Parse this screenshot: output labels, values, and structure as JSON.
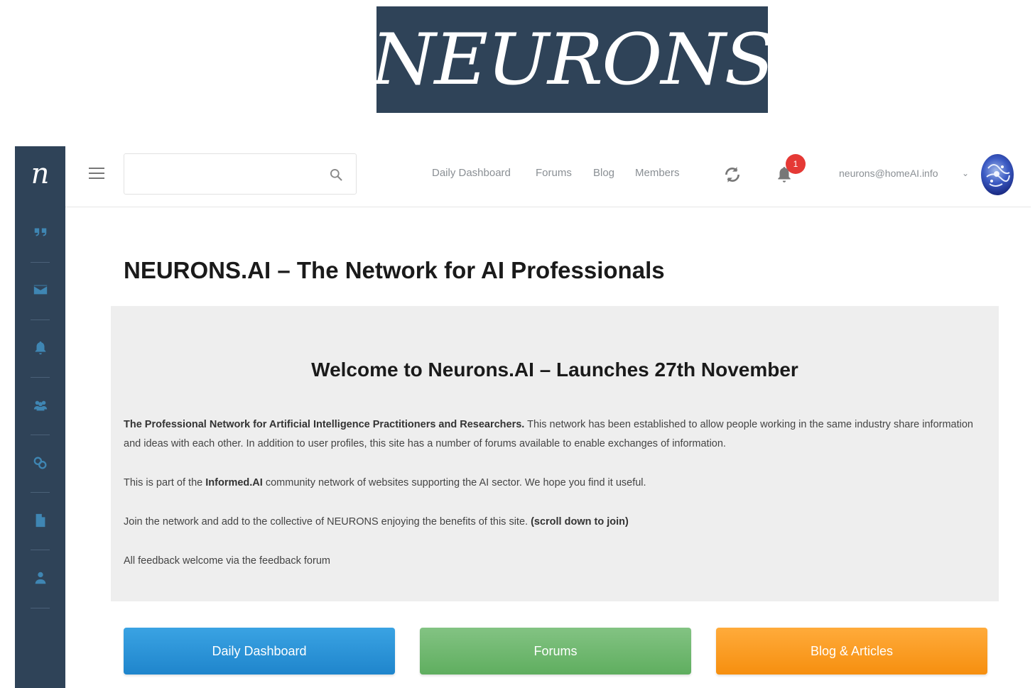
{
  "banner": {
    "logo_text": "NEURONS"
  },
  "sidebar": {
    "logo_letter": "n",
    "items": [
      {
        "icon": "quote-icon"
      },
      {
        "icon": "envelope-icon"
      },
      {
        "icon": "bell-icon"
      },
      {
        "icon": "users-icon"
      },
      {
        "icon": "share-icon"
      },
      {
        "icon": "document-icon"
      },
      {
        "icon": "user-icon"
      }
    ]
  },
  "topbar": {
    "search": {
      "value": "",
      "placeholder": ""
    },
    "nav": [
      "Daily Dashboard",
      "Forums",
      "Blog",
      "Members"
    ],
    "notification_count": "1",
    "user_email": "neurons@homeAI.info",
    "chevron": "⌄"
  },
  "content": {
    "title": "NEURONS.AI – The Network for AI Professionals",
    "welcome_heading": "Welcome to Neurons.AI – Launches 27th November",
    "para1_bold": "The Professional Network for Artificial Intelligence Practitioners and Researchers.",
    "para1_text": " This network has been established to allow people working in the same industry share information and ideas with each other. In addition to user profiles, this site has a number of forums available to enable exchanges of information.",
    "para2_pre": "This is part of the ",
    "para2_bold": "Informed.AI",
    "para2_post": " community network of websites supporting the AI sector. We hope you find it useful.",
    "para3_text": "Join the network and add to the collective of NEURONS enjoying the benefits of this site. ",
    "para3_bold": "(scroll down to join)",
    "para4_text": "All feedback welcome via the feedback forum"
  },
  "buttons": {
    "dashboard": "Daily Dashboard",
    "forums": "Forums",
    "blog": "Blog & Articles"
  },
  "colors": {
    "sidebar_bg": "#2f4358",
    "sidebar_icon": "#3f86b3",
    "blue": "#1f85cc",
    "green": "#5fae5f",
    "orange": "#f68f0f",
    "badge": "#e53935"
  }
}
